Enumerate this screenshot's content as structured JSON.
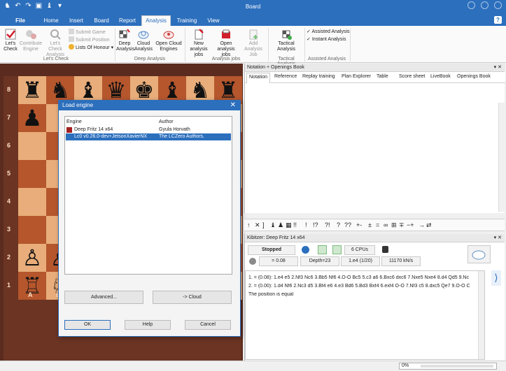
{
  "window": {
    "title": "Board"
  },
  "tabs": [
    "File",
    "Home",
    "Insert",
    "Board",
    "Report",
    "Analysis",
    "Training",
    "View"
  ],
  "active_tab": "Analysis",
  "ribbon": {
    "lets_check": {
      "check_label": "Let's Check",
      "contribute_label": "Contribute Engine",
      "lets_check_analysis_label": "Let's Check Analysis",
      "submit_game": "Submit Game",
      "submit_position": "Submit Position",
      "lists_of_honour": "Lists Of Honour",
      "group_label": "Let's Check"
    },
    "deep_analysis": {
      "deep_label": "Deep Analysis",
      "cloud_label": "Cloud Analysis",
      "open_cloud_label": "Open Cloud Engines",
      "group_label": "Deep Analysis"
    },
    "analysis_jobs": {
      "new_label": "New analysis jobs",
      "open_label": "Open analysis jobs",
      "add_label": "Add Analysis Job",
      "group_label": "Analysis jobs"
    },
    "tactical": {
      "label": "Tactical Analysis",
      "group_label": "Tactical Analysis"
    },
    "assisted": {
      "assisted_analysis": "Assisted Analysis",
      "instant_analysis": "Instant Analysis",
      "group_label": "Assisted Analysis"
    }
  },
  "board": {
    "ranks": [
      "8",
      "7",
      "6",
      "5",
      "4",
      "3",
      "2",
      "1"
    ],
    "files": [
      "A",
      "B"
    ],
    "pieces": [
      {
        "row": 0,
        "col": 0,
        "glyph": "♜"
      },
      {
        "row": 0,
        "col": 1,
        "glyph": "♞"
      },
      {
        "row": 0,
        "col": 2,
        "glyph": "♝"
      },
      {
        "row": 0,
        "col": 3,
        "glyph": "♛"
      },
      {
        "row": 0,
        "col": 4,
        "glyph": "♚"
      },
      {
        "row": 0,
        "col": 5,
        "glyph": "♝"
      },
      {
        "row": 0,
        "col": 6,
        "glyph": "♞"
      },
      {
        "row": 0,
        "col": 7,
        "glyph": "♜"
      },
      {
        "row": 1,
        "col": 0,
        "glyph": "♟"
      },
      {
        "row": 1,
        "col": 7,
        "glyph": "♟"
      },
      {
        "row": 6,
        "col": 0,
        "glyph": "♙"
      },
      {
        "row": 6,
        "col": 1,
        "glyph": "♙"
      },
      {
        "row": 7,
        "col": 0,
        "glyph": "♖"
      },
      {
        "row": 7,
        "col": 1,
        "glyph": "♘"
      }
    ]
  },
  "dialog": {
    "title": "Load engine",
    "columns": {
      "engine": "Engine",
      "author": "Author"
    },
    "engines": [
      {
        "name": "Deep Fritz 14 x64",
        "author": "Gyula Horvath",
        "selected": false
      },
      {
        "name": "Lc0 v0.26.0-dev+JetsonXavierNX",
        "author": "The LCZero Authors.",
        "selected": true
      }
    ],
    "advanced_button": "Advanced...",
    "cloud_button": "-> Cloud",
    "ok_button": "OK",
    "help_button": "Help",
    "cancel_button": "Cancel"
  },
  "notation": {
    "title": "Notation + Openings Book",
    "tabs": [
      "Notation",
      "Reference",
      "Replay training",
      "Plan Explorer",
      "Table",
      "Score sheet",
      "LiveBook",
      "Openings Book"
    ],
    "active_tab": "Notation"
  },
  "symbols": [
    "↑",
    "✕",
    "]",
    "♝",
    "♟",
    "▦",
    "!!",
    "!",
    "!?",
    "?!",
    "?",
    "??",
    "+-",
    "±",
    "=",
    "∞",
    "⊞",
    "∓",
    "−+",
    "→",
    "⇄"
  ],
  "kibitzer": {
    "title": "Kibitzer: Deep Fritz 14 x64",
    "status": "Stopped",
    "cpus": "6 CPUs",
    "eval": "= 0.08",
    "depth": "Depth=23",
    "move": "1.e4 (1/20)",
    "speed": "11170 kN/s",
    "lines": [
      "1. = (0.08): 1.e4 e5 2.Nf3 Nc6 3.Bb5 Nf6 4.O-O Bc5 5.c3 a6 6.Bxc6 dxc6 7.Nxe5 Nxe4 8.d4 Qd5 9.Nc",
      "2. = (0.00): 1.d4 Nf6 2.Nc3 d5 3.Bf4 e6 4.e3 Bd6 5.Bd3 Bxf4 6.exf4 O-O 7.Nf3 c5 8.dxc5 Qe7 9.O-O C",
      "The position is equal"
    ]
  },
  "status": {
    "progress_text": "0%",
    "progress": 0
  },
  "colors": {
    "accent": "#2c6fbd",
    "board_light": "#e8ad7a",
    "board_dark": "#b5562d"
  }
}
